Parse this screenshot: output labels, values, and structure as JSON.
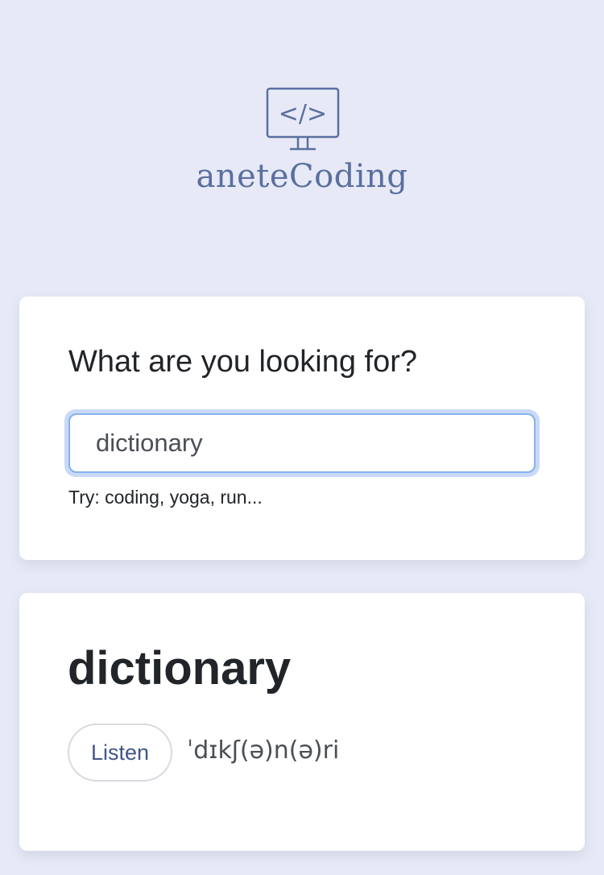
{
  "brand": {
    "name": "aneteCoding",
    "icon": "code-monitor-icon",
    "icon_glyph": "</>",
    "color": "#5a6fa0"
  },
  "search": {
    "heading": "What are you looking for?",
    "value": "dictionary",
    "hint": "Try: coding, yoga, run..."
  },
  "result": {
    "word": "dictionary",
    "listen_label": "Listen",
    "phonetic": "ˈdɪkʃ(ə)n(ə)ri"
  },
  "colors": {
    "background": "#e7eaf6",
    "card": "#ffffff",
    "input_focus": "#86b0ef",
    "button_text": "#3f5688"
  }
}
